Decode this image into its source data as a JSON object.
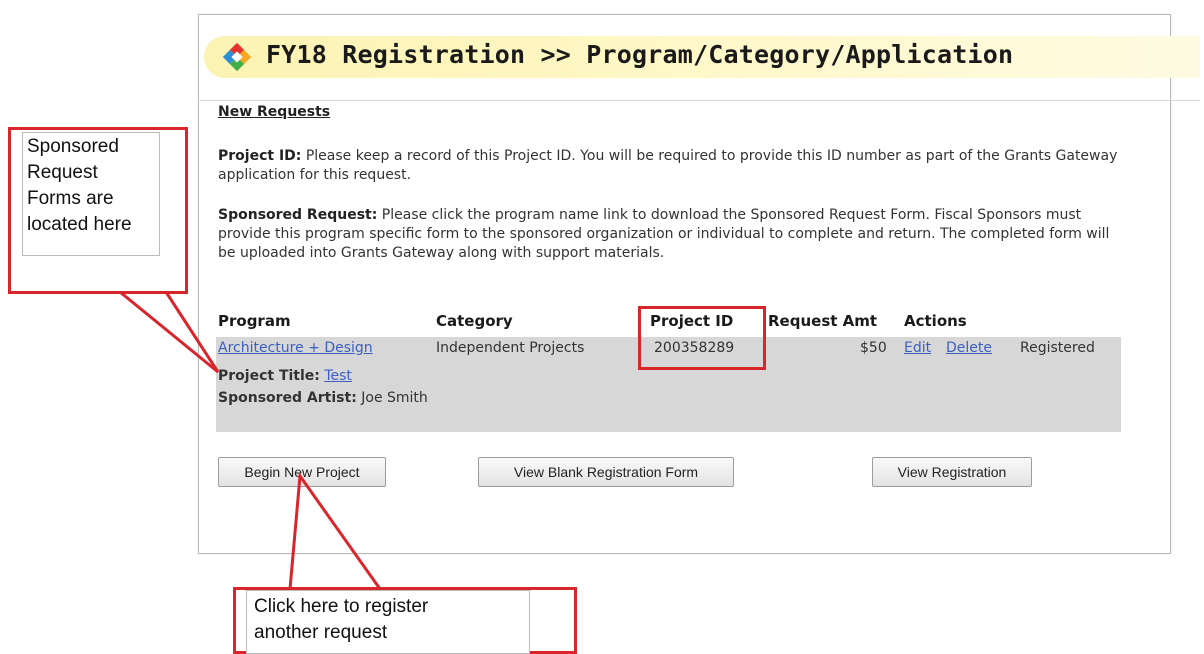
{
  "header": {
    "title": "FY18 Registration >> Program/Category/Application",
    "icon": "diamond-logo-icon"
  },
  "section": {
    "heading": "New Requests"
  },
  "project_id_note": {
    "label": "Project ID:",
    "text": "Please keep a record of this Project ID. You will be required to provide this ID number as part of the Grants Gateway application for this request."
  },
  "sponsored_note": {
    "label": "Sponsored Request:",
    "text": "Please click the program name link to download the Sponsored Request Form. Fiscal Sponsors must provide this program specific form to the sponsored organization or individual to complete and return. The completed form will be uploaded into Grants Gateway along with support materials."
  },
  "table": {
    "columns": [
      "Program",
      "Category",
      "Project ID",
      "Request Amt",
      "Actions"
    ],
    "row": {
      "program": "Architecture + Design",
      "category": "Independent Projects",
      "project_id": "200358289",
      "request_amt": "$50",
      "edit": "Edit",
      "delete": "Delete",
      "status": "Registered",
      "project_title_label": "Project Title:",
      "project_title": "Test",
      "sponsored_artist_label": "Sponsored Artist:",
      "sponsored_artist": "Joe Smith"
    }
  },
  "buttons": {
    "begin_new_project": "Begin New Project",
    "view_blank_form": "View Blank Registration Form",
    "view_registration": "View Registration"
  },
  "annotations": {
    "left_callout": [
      "Sponsored",
      "Request",
      "Forms are",
      "located here"
    ],
    "bottom_callout": [
      "Click here to register",
      "another request"
    ]
  },
  "colors": {
    "callout_red": "#d9262c",
    "link_blue": "#3c5fc2",
    "title_highlight": "#fbf3b2",
    "row_background": "#d7d7d7"
  }
}
